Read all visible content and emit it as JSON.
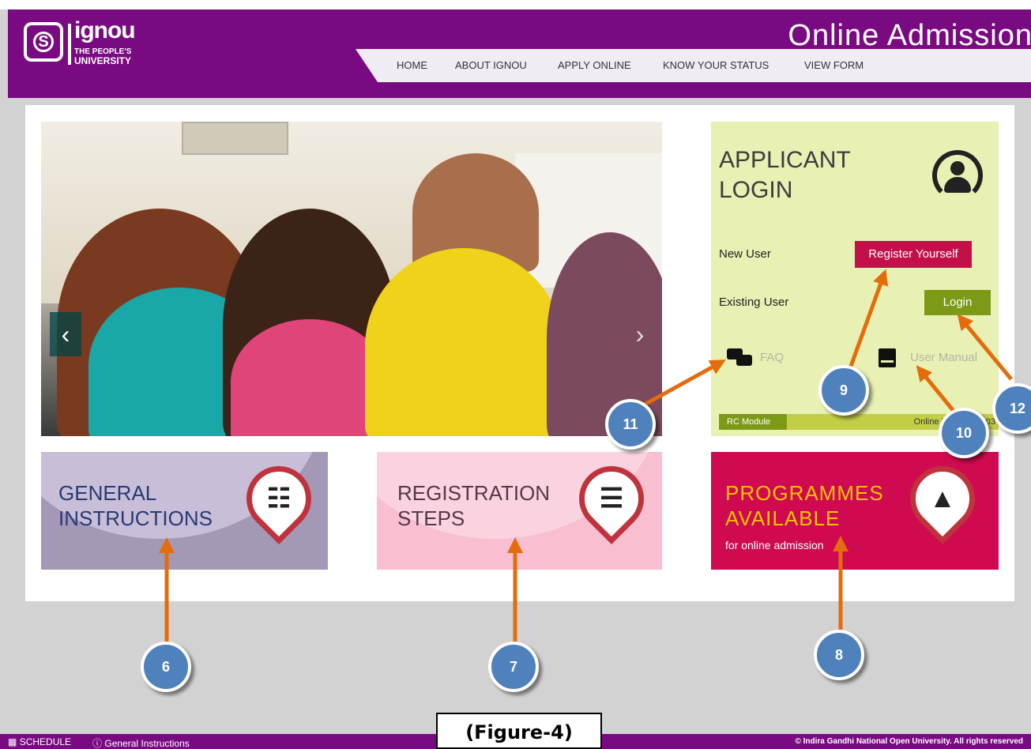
{
  "header": {
    "logo_name": "ignou",
    "logo_tagline_1": "THE PEOPLE'S",
    "logo_tagline_2": "UNIVERSITY",
    "title": "Online Admission",
    "nav": [
      "HOME",
      "ABOUT IGNOU",
      "APPLY ONLINE",
      "KNOW YOUR STATUS",
      "VIEW FORM"
    ]
  },
  "slider": {
    "prev_label": "‹",
    "next_label": "›"
  },
  "login_box": {
    "title_line1": "APPLICANT",
    "title_line2": "LOGIN",
    "new_user_label": "New User",
    "register_button": "Register Yourself",
    "existing_user_label": "Existing User",
    "login_button": "Login",
    "faq_label": "FAQ",
    "user_manual_label": "User Manual",
    "rc_module_label": "RC Module",
    "online_registration_text": "Online Registra...903"
  },
  "tiles": {
    "general_line1": "GENERAL",
    "general_line2": "INSTRUCTIONS",
    "registration_line1": "REGISTRATION",
    "registration_line2": "STEPS",
    "programmes_line1": "PROGRAMMES",
    "programmes_line2": "AVAILABLE",
    "programmes_sub": "for online admission"
  },
  "callouts": [
    "6",
    "7",
    "8",
    "9",
    "10",
    "11",
    "12"
  ],
  "footer": {
    "schedule": "SCHEDULE",
    "general_instructions": "General Instructions",
    "copyright": "© Indira Gandhi National Open University. All rights reserved"
  },
  "figure_label": "(Figure-4)",
  "colors": {
    "header_purple": "#7a0a82",
    "login_bg": "#e8f0b4",
    "register_red": "#c3104b",
    "login_green": "#7d9a17",
    "callout_blue": "#4f81bd",
    "arrow_orange": "#e46c0a"
  }
}
